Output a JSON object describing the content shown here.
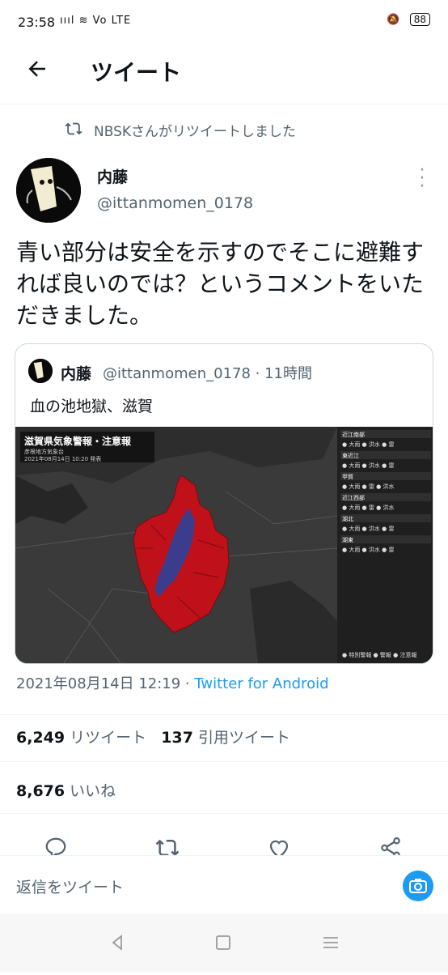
{
  "status": {
    "time": "23:58",
    "icons": "ıııl ≋ Vo LTE",
    "battery": "88"
  },
  "header": {
    "title": "ツイート"
  },
  "retweet": {
    "label": "NBSKさんがリツイートしました"
  },
  "tweet": {
    "name": "内藤",
    "handle": "@ittanmomen_0178",
    "text": "青い部分は安全を示すのでそこに避難すれば良いのでは？というコメントをいただきました。",
    "timestamp": "2021年08月14日 12:19 · ",
    "client": "Twitter for Android"
  },
  "quote": {
    "name": "内藤",
    "handle_time": "@ittanmomen_0178 · 11時間",
    "text": "血の池地獄、滋賀",
    "map": {
      "title": "滋賀県気象警報・注意報",
      "office": "彦根地方気象台",
      "issued": "2021年08月14日 10:20 発表",
      "regions": [
        {
          "name": "近江南部",
          "items": "● 大雨 ● 洪水 ● 雷"
        },
        {
          "name": "東近江",
          "items": "● 大雨 ● 洪水 ● 雷"
        },
        {
          "name": "甲賀",
          "items": "● 大雨 ● 雷 ● 洪水"
        },
        {
          "name": "近江西部",
          "items": "● 大雨 ● 雷 ● 洪水"
        },
        {
          "name": "湖北",
          "items": "● 大雨 ● 洪水 ● 雷"
        },
        {
          "name": "湖東",
          "items": "● 大雨 ● 洪水 ● 雷"
        }
      ],
      "legend": "● 特別警報 ● 警報 ● 注意報",
      "colors": {
        "warning": "#c0111b",
        "lake": "#3b3d8c",
        "land": "#2d2d2d"
      }
    }
  },
  "stats": {
    "retweets": "6,249",
    "retweets_label": "リツイート",
    "quotes": "137",
    "quotes_label": "引用ツイート",
    "likes": "8,676",
    "likes_label": "いいね"
  },
  "reply": {
    "placeholder": "返信をツイート"
  },
  "icons": [
    "back-arrow-icon",
    "retweet-icon",
    "more-icon",
    "reply-icon",
    "like-icon",
    "share-icon",
    "camera-icon"
  ],
  "accent": "#1d9bf0"
}
